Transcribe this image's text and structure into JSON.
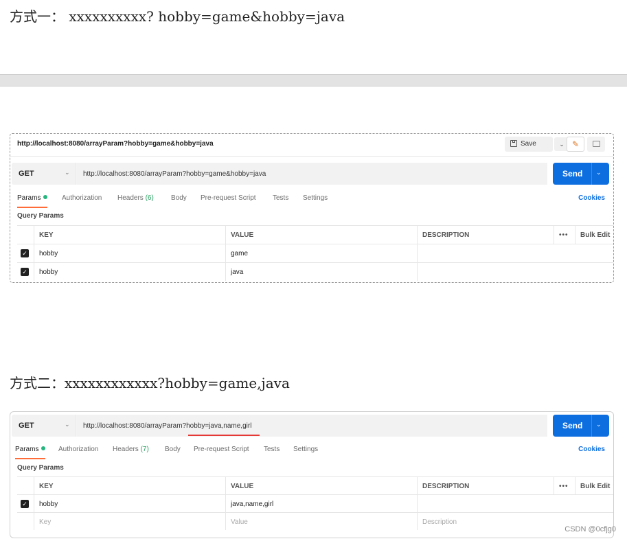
{
  "headings": {
    "method_one": "方式一： xxxxxxxxxx? hobby=game&hobby=java",
    "method_two": "方式二：xxxxxxxxxxxx?hobby=game,java"
  },
  "colors": {
    "send_blue": "#0d6ee0",
    "active_tab_underline": "#ff6c37",
    "params_dot_green": "#26b47f",
    "annotation_red": "#e53935"
  },
  "panel1": {
    "title_url": "http://localhost:8080/arrayParam?hobby=game&hobby=java",
    "save_label": "Save",
    "save_icon": "floppy-disk-icon",
    "edit_icon": "pencil-icon",
    "comment_icon": "comment-icon",
    "method": "GET",
    "url": "http://localhost:8080/arrayParam?hobby=game&hobby=java",
    "send_label": "Send",
    "tabs": {
      "params": "Params",
      "authorization": "Authorization",
      "headers": "Headers",
      "headers_count": "(6)",
      "body": "Body",
      "prerequest": "Pre-request Script",
      "tests": "Tests",
      "settings": "Settings"
    },
    "cookies": "Cookies",
    "query_params_label": "Query Params",
    "table": {
      "headers": {
        "key": "KEY",
        "value": "VALUE",
        "description": "DESCRIPTION",
        "more": "•••",
        "bulk_edit": "Bulk Edit"
      },
      "rows": [
        {
          "key": "hobby",
          "value": "game",
          "checked": true
        },
        {
          "key": "hobby",
          "value": "java",
          "checked": true
        }
      ]
    }
  },
  "panel2": {
    "method": "GET",
    "url": "http://localhost:8080/arrayParam?hobby=java,name,girl",
    "send_label": "Send",
    "tabs": {
      "params": "Params",
      "authorization": "Authorization",
      "headers": "Headers",
      "headers_count": "(7)",
      "body": "Body",
      "prerequest": "Pre-request Script",
      "tests": "Tests",
      "settings": "Settings"
    },
    "cookies": "Cookies",
    "query_params_label": "Query Params",
    "table": {
      "headers": {
        "key": "KEY",
        "value": "VALUE",
        "description": "DESCRIPTION",
        "more": "•••",
        "bulk_edit": "Bulk Edit"
      },
      "rows": [
        {
          "key": "hobby",
          "value": "java,name,girl",
          "checked": true
        }
      ],
      "placeholder_row": {
        "key": "Key",
        "value": "Value",
        "description": "Description"
      }
    }
  },
  "watermark": "CSDN @0cfjg0"
}
